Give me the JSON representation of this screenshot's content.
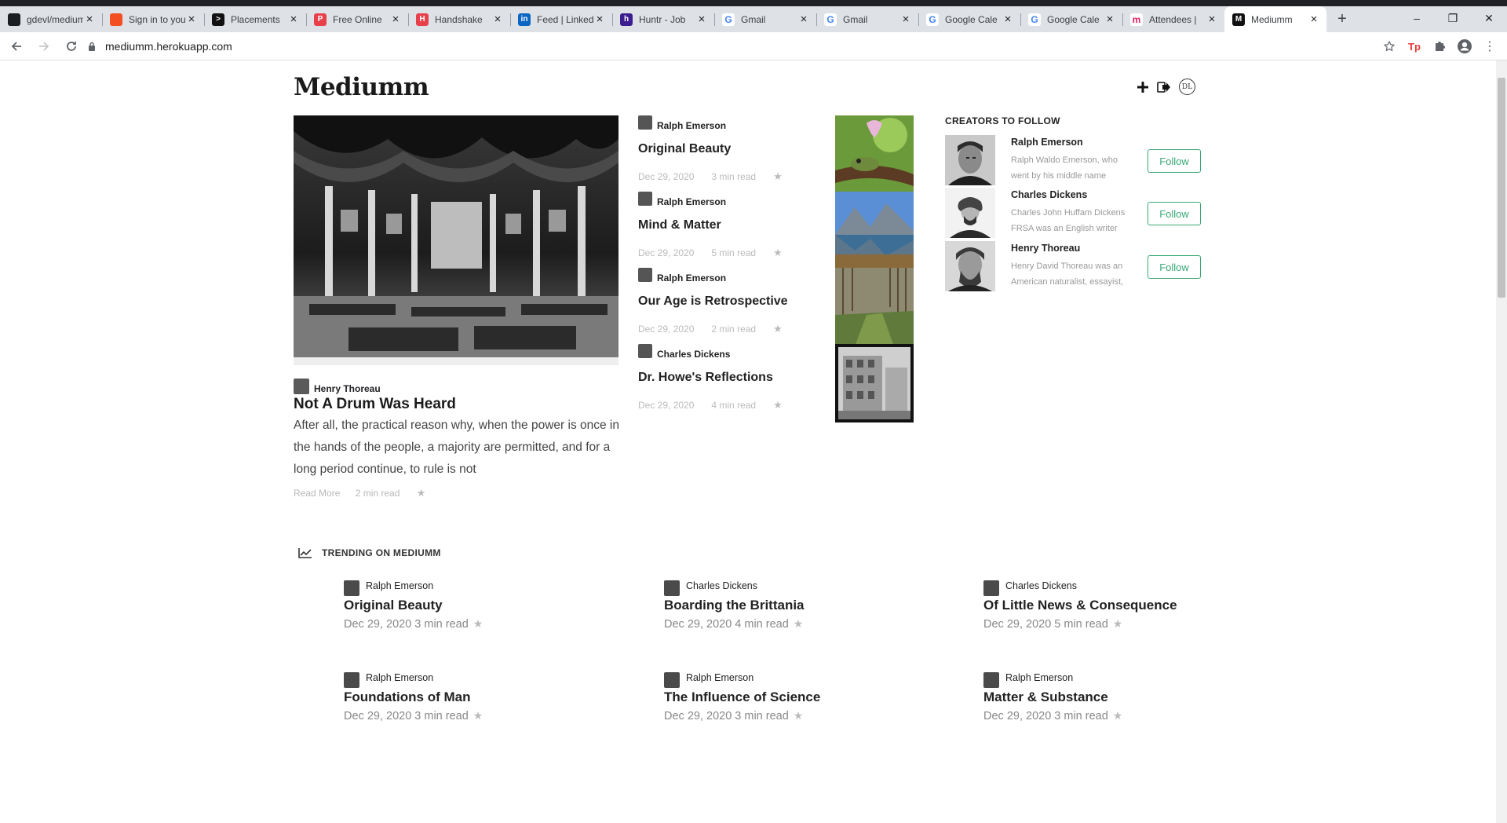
{
  "browser": {
    "tabs": [
      {
        "title": "gdevl/medium",
        "favicon": "github-icon",
        "color": "#1b1f23",
        "glyph": ""
      },
      {
        "title": "Sign in to your",
        "favicon": "microsoft-icon",
        "color": "#f25022",
        "glyph": ""
      },
      {
        "title": "Placements",
        "favicon": "placements-icon",
        "color": "#111",
        "glyph": ">"
      },
      {
        "title": "Free Online",
        "favicon": "free-online-icon",
        "color": "#e8404b",
        "glyph": "P"
      },
      {
        "title": "Handshake",
        "favicon": "handshake-icon",
        "color": "#e8404b",
        "glyph": "H"
      },
      {
        "title": "Feed | LinkedIn",
        "favicon": "linkedin-icon",
        "color": "#0a66c2",
        "glyph": "in"
      },
      {
        "title": "Huntr - Job",
        "favicon": "huntr-icon",
        "color": "#3b1d8f",
        "glyph": "h"
      },
      {
        "title": "Gmail",
        "favicon": "google-icon",
        "color": "#fff",
        "glyph": "G"
      },
      {
        "title": "Gmail",
        "favicon": "google-icon",
        "color": "#fff",
        "glyph": "G"
      },
      {
        "title": "Google Cale",
        "favicon": "google-icon",
        "color": "#fff",
        "glyph": "G"
      },
      {
        "title": "Google Cale",
        "favicon": "google-icon",
        "color": "#fff",
        "glyph": "G"
      },
      {
        "title": "Attendees |",
        "favicon": "attendees-icon",
        "color": "#fff",
        "glyph": "m"
      },
      {
        "title": "Mediumm",
        "favicon": "mediumm-icon",
        "color": "#111",
        "glyph": "M",
        "active": true
      }
    ],
    "url": "mediumm.herokuapp.com"
  },
  "site": {
    "logo": "Mediumm"
  },
  "hero": {
    "author": "Henry Thoreau",
    "title": "Not A Drum Was Heard",
    "excerpt": "After all, the practical reason why, when the power is once in the hands of the people, a majority are permitted, and for a long period continue, to rule is not",
    "read_more": "Read More",
    "read_time": "2 min read"
  },
  "middle": [
    {
      "author": "Ralph Emerson",
      "title": "Original Beauty",
      "date": "Dec 29, 2020",
      "read": "3 min read"
    },
    {
      "author": "Ralph Emerson",
      "title": "Mind & Matter",
      "date": "Dec 29, 2020",
      "read": "5 min read"
    },
    {
      "author": "Ralph Emerson",
      "title": "Our Age is Retrospective",
      "date": "Dec 29, 2020",
      "read": "2 min read"
    },
    {
      "author": "Charles Dickens",
      "title": "Dr. Howe's Reflections",
      "date": "Dec 29, 2020",
      "read": "4 min read"
    }
  ],
  "creators": {
    "heading": "CREATORS TO FOLLOW",
    "follow_label": "Follow",
    "items": [
      {
        "name": "Ralph Emerson",
        "bio": "Ralph Waldo Emerson, who went by his middle name"
      },
      {
        "name": "Charles Dickens",
        "bio": "Charles John Huffam Dickens FRSA was an English writer"
      },
      {
        "name": "Henry Thoreau",
        "bio": "Henry David Thoreau was an American naturalist, essayist,"
      }
    ]
  },
  "trending": {
    "heading": "TRENDING ON MEDIUMM",
    "items": [
      {
        "author": "Ralph Emerson",
        "title": "Original Beauty",
        "meta": "Dec 29, 2020 3 min read"
      },
      {
        "author": "Charles Dickens",
        "title": "Boarding the Brittania",
        "meta": "Dec 29, 2020 4 min read"
      },
      {
        "author": "Charles Dickens",
        "title": "Of Little News & Consequence",
        "meta": "Dec 29, 2020 5 min read"
      },
      {
        "author": "Ralph Emerson",
        "title": "Foundations of Man",
        "meta": "Dec 29, 2020 3 min read"
      },
      {
        "author": "Ralph Emerson",
        "title": "The Influence of Science",
        "meta": "Dec 29, 2020 3 min read"
      },
      {
        "author": "Ralph Emerson",
        "title": "Matter & Substance",
        "meta": "Dec 29, 2020 3 min read"
      }
    ]
  },
  "colors": {
    "follow_green": "#3aa776",
    "tab_bar": "#dee1e6"
  }
}
